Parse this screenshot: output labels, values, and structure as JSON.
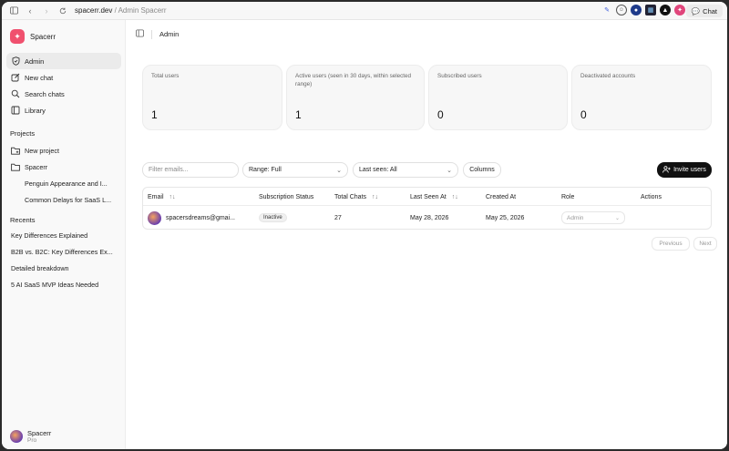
{
  "browser": {
    "url_host": "spacerr.dev",
    "url_sep": " / ",
    "url_page": "Admin Spacerr",
    "chat_label": "Chat"
  },
  "sidebar": {
    "brand": "Spacerr",
    "nav": [
      {
        "label": "Admin",
        "icon": "shield-icon"
      },
      {
        "label": "New chat",
        "icon": "edit-icon"
      },
      {
        "label": "Search chats",
        "icon": "search-icon"
      },
      {
        "label": "Library",
        "icon": "library-icon"
      }
    ],
    "projects_title": "Projects",
    "projects": [
      {
        "label": "New project"
      },
      {
        "label": "Spacerr"
      },
      {
        "label": "Penguin Appearance and I..."
      },
      {
        "label": "Common Delays for SaaS L..."
      }
    ],
    "recents_title": "Recents",
    "recents": [
      {
        "label": "Key Differences Explained"
      },
      {
        "label": "B2B vs. B2C: Key Differences Ex..."
      },
      {
        "label": "Detailed breakdown"
      },
      {
        "label": "5 AI SaaS MVP Ideas Needed"
      }
    ],
    "user": {
      "name": "Spacerr",
      "plan": "Pro"
    }
  },
  "main": {
    "breadcrumb": "Admin",
    "stats": [
      {
        "label": "Total users",
        "value": "1"
      },
      {
        "label": "Active users (seen in 30 days, within selected range)",
        "value": "1"
      },
      {
        "label": "Subscribed users",
        "value": "0"
      },
      {
        "label": "Deactivated accounts",
        "value": "0"
      }
    ],
    "filters": {
      "email_placeholder": "Filter emails...",
      "range": "Range: Full",
      "last_seen": "Last seen: All",
      "columns": "Columns",
      "invite": "Invite users"
    },
    "table": {
      "headers": [
        "Email",
        "Subscription Status",
        "Total Chats",
        "Last Seen At",
        "Created At",
        "Role",
        "Actions"
      ],
      "rows": [
        {
          "email": "spacersdreams@gmai...",
          "status": "Inactive",
          "total_chats": "27",
          "last_seen": "May 28, 2026",
          "created": "May 25, 2026",
          "role": "Admin"
        }
      ]
    },
    "pagination": {
      "previous": "Previous",
      "next": "Next"
    }
  }
}
